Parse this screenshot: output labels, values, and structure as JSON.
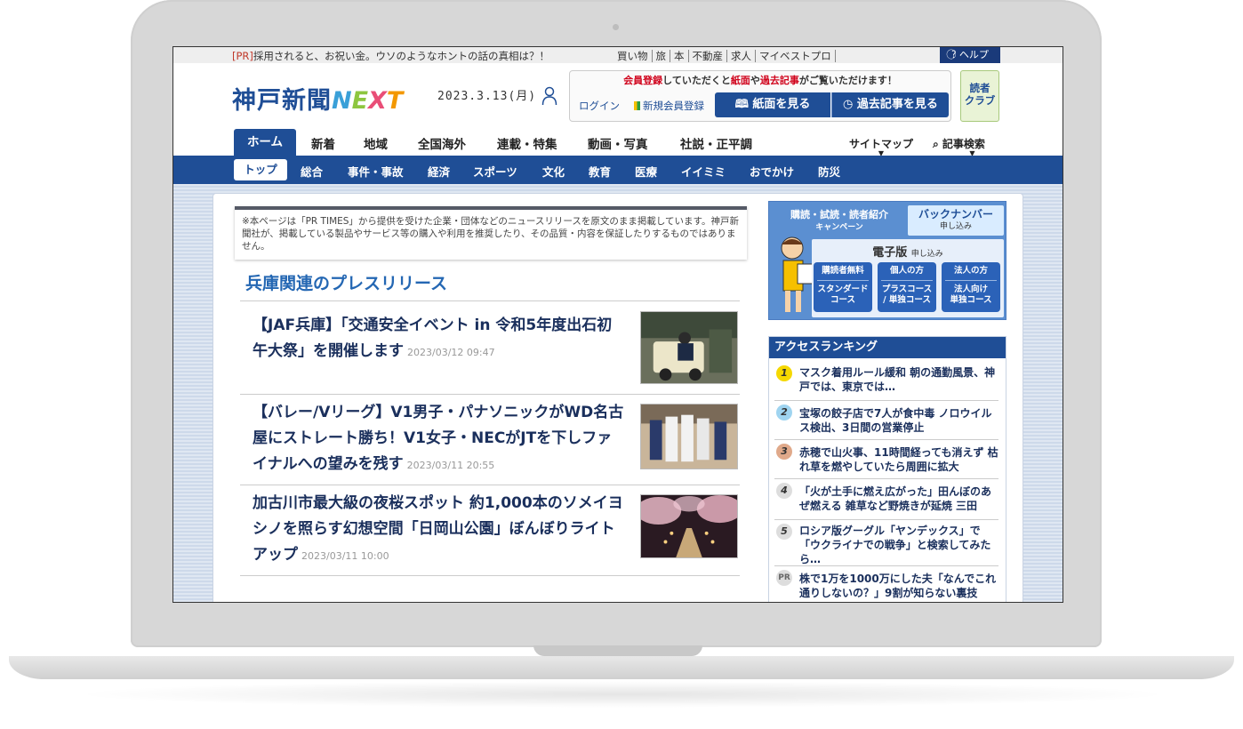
{
  "topbar": {
    "pr_tag": "[PR]",
    "pr_text": "採用されると、お祝い金。ウソのようなホントの話の真相は？！",
    "links": [
      "買い物",
      "旅",
      "本",
      "不動産",
      "求人",
      "マイベストプロ"
    ],
    "help": "ヘルプ"
  },
  "header": {
    "logo_main": "神戸新聞",
    "logo_next": [
      "N",
      "E",
      "X",
      "T"
    ],
    "date": "2023.3.13(月)",
    "notice_1": "会員登録",
    "notice_2": "していただくと",
    "notice_3": "紙面",
    "notice_4": "や",
    "notice_5": "過去記事",
    "notice_6": "がご覧いただけます！",
    "login": "ログイン",
    "register": "新規会員登録",
    "view_paper": "紙面を見る",
    "view_past": "過去記事を見る",
    "reader_club": "読者\nクラブ"
  },
  "mainnav": {
    "home": "ホーム",
    "items": [
      "新着",
      "地域",
      "全国海外",
      "連載・特集",
      "動画・写真",
      "社説・正平調"
    ],
    "sitemap": "サイトマップ",
    "search": "記事検索"
  },
  "subnav": {
    "top": "トップ",
    "items": [
      "総合",
      "事件・事故",
      "経済",
      "スポーツ",
      "文化",
      "教育",
      "医療",
      "イイミミ",
      "おでかけ",
      "防災"
    ]
  },
  "main": {
    "disclaimer": "※本ページは「PR TIMES」から提供を受けた企業・団体などのニュースリリースを原文のまま掲載しています。神戸新聞社が、掲載している製品やサービス等の購入や利用を推奨したり、その品質・内容を保証したりするものではありません。",
    "section_title": "兵庫関連のプレスリリース",
    "articles": [
      {
        "headline": "【JAF兵庫】「交通安全イベント in 令和5年度出石初午大祭」を開催します",
        "time": "2023/03/12 09:47"
      },
      {
        "headline": "【バレー/Vリーグ】V1男子・パナソニックがWD名古屋にストレート勝ち！V1女子・NECがJTを下しファイナルへの望みを残す",
        "time": "2023/03/11 20:55"
      },
      {
        "headline": "加古川市最大級の夜桜スポット 約1,000本のソメイヨシノを照らす幻想空間「日岡山公園」ぼんぼりライトアップ",
        "time": "2023/03/11 10:00"
      }
    ]
  },
  "sidebar": {
    "campaign_title": "購読・試読・読者紹介",
    "campaign_sub": "キャンペーン",
    "backnumber": "バックナンバー",
    "backnumber_sub": "申し込み",
    "digital_title": "電子版",
    "digital_sub": "申し込み",
    "buttons": [
      {
        "top": "購読者無料",
        "bottom": "スタンダード\nコース"
      },
      {
        "top": "個人の方",
        "bottom": "プラスコース\n/ 単独コース"
      },
      {
        "top": "法人の方",
        "bottom": "法人向け\n単独コース"
      }
    ],
    "ranking_title": "アクセスランキング",
    "ranking": [
      {
        "num": "1",
        "text": "マスク着用ルール緩和 朝の通勤風景、神戸では、東京では…",
        "color": "#f5d800"
      },
      {
        "num": "2",
        "text": "宝塚の餃子店で7人が食中毒 ノロウイルス検出、3日間の営業停止",
        "color": "#9fd4f0"
      },
      {
        "num": "3",
        "text": "赤穂で山火事、11時間経っても消えず 枯れ草を燃やしていたら周囲に拡大",
        "color": "#e0a98a"
      },
      {
        "num": "4",
        "text": "「火が土手に燃え広がった」田んぼのあぜ燃える 雑草など野焼きが延焼 三田",
        "color": "#dddddd"
      },
      {
        "num": "5",
        "text": "ロシア版グーグル「ヤンデックス」で「ウクライナでの戦争」と検索してみたら…",
        "color": "#dddddd"
      },
      {
        "num": "PR",
        "text": "株で1万を1000万にした夫「なんでこれ通りしないの？」9割が知らない裏技",
        "color": "#dddddd"
      }
    ]
  }
}
